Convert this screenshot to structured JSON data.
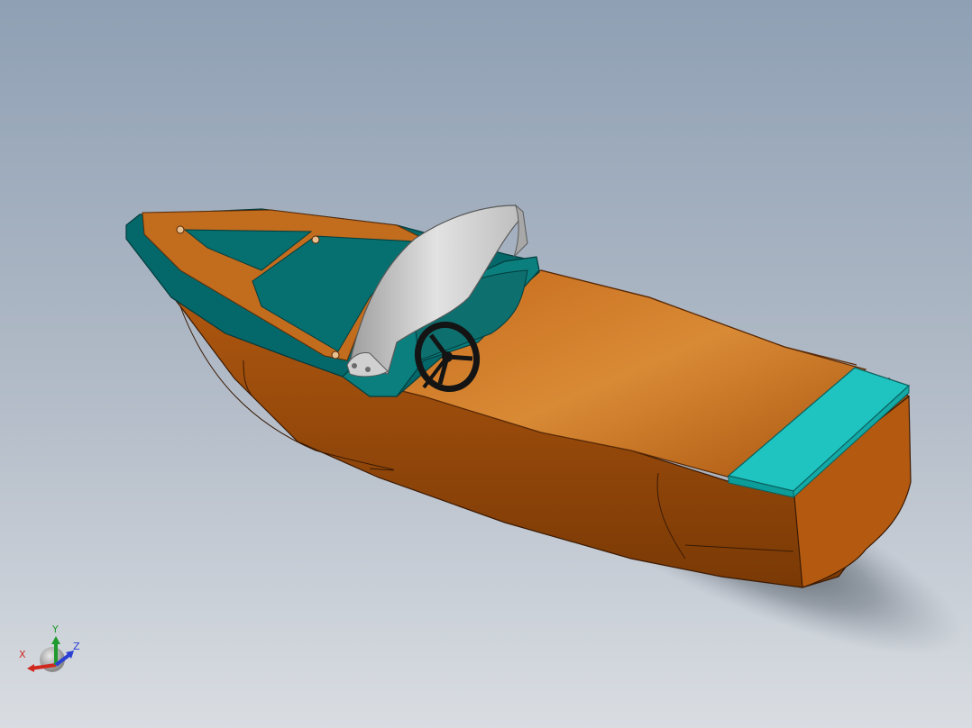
{
  "viewport": {
    "background_top": "#8fa0b4",
    "background_bottom": "#d6dadf"
  },
  "model": {
    "hull_color": "#a64f0d",
    "deck_color": "#04686a",
    "trim_color": "#c26c1e",
    "seat_color": "#c7c7c7",
    "rear_pad_color": "#1fc3c0",
    "wheel_color": "#141414"
  },
  "triad": {
    "x_label": "X",
    "y_label": "Y",
    "z_label": "Z",
    "x_color": "#d0281e",
    "y_color": "#1f9a2e",
    "z_color": "#2a3fd4"
  }
}
